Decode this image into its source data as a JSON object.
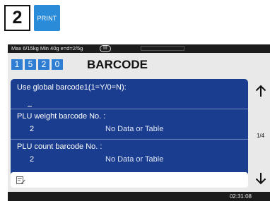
{
  "step": {
    "number": "2",
    "print_label": "PRINT"
  },
  "status": {
    "spec": "Max 6/15kg Min 40g e=d=2/5g",
    "class_badge": "III"
  },
  "header": {
    "digits": [
      "1",
      "5",
      "2",
      "0"
    ],
    "title": "BARCODE"
  },
  "fields": [
    {
      "label": "Use global barcode1(1=Y/0=N):",
      "value": "",
      "note": ""
    },
    {
      "label": "PLU weight barcode No. :",
      "value": "2",
      "note": "No Data or Table"
    },
    {
      "label": "PLU count barcode No. :",
      "value": "2",
      "note": "No Data or Table"
    }
  ],
  "pager": {
    "text": "1/4"
  },
  "icons": {
    "up": "arrow-up-icon",
    "down": "arrow-down-icon",
    "edit": "edit-note-icon"
  },
  "clock": "02:31:08",
  "colors": {
    "panel": "#1a3d8f",
    "digit": "#2e7fd4",
    "print": "#2a8bd8"
  }
}
